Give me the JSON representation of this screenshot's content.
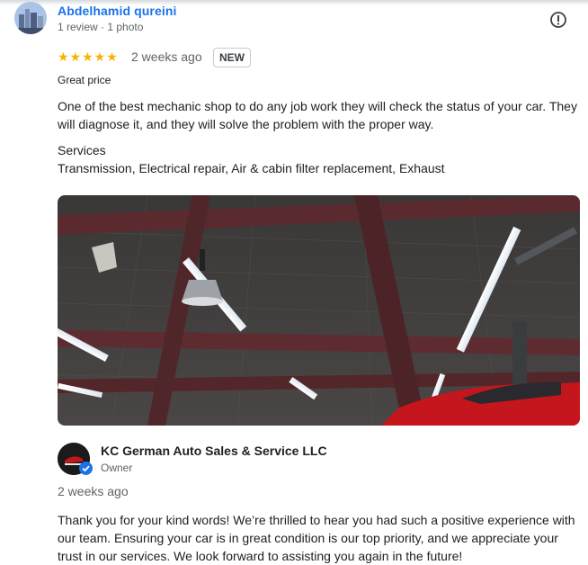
{
  "reviewer": {
    "name": "Abdelhamid qureini",
    "meta": "1 review · 1 photo"
  },
  "review": {
    "rating": 5,
    "stars": "★★★★★",
    "time": "2 weeks ago",
    "badge": "NEW",
    "price_label": "Great price",
    "text": "One of the best mechanic shop to do any job work they will check the status of your car. They will diagnose it, and they will solve the problem with the proper way.",
    "services_label": "Services",
    "services_value": "Transmission, Electrical repair, Air & cabin filter replacement, Exhaust"
  },
  "owner_reply": {
    "name": "KC German Auto Sales & Service LLC",
    "role": "Owner",
    "time": "2 weeks ago",
    "text": "Thank you for your kind words! We’re thrilled to hear you had such a positive experience with our team. Ensuring your car is in great condition is our top priority, and we appreciate your trust in our services. We look forward to assisting you again in the future!"
  },
  "icons": {
    "report": "report-icon",
    "verified": "verified-badge-icon",
    "star": "star-icon"
  },
  "colors": {
    "link": "#1a73e8",
    "star": "#f5b400",
    "secondary_text": "#5f6368"
  }
}
